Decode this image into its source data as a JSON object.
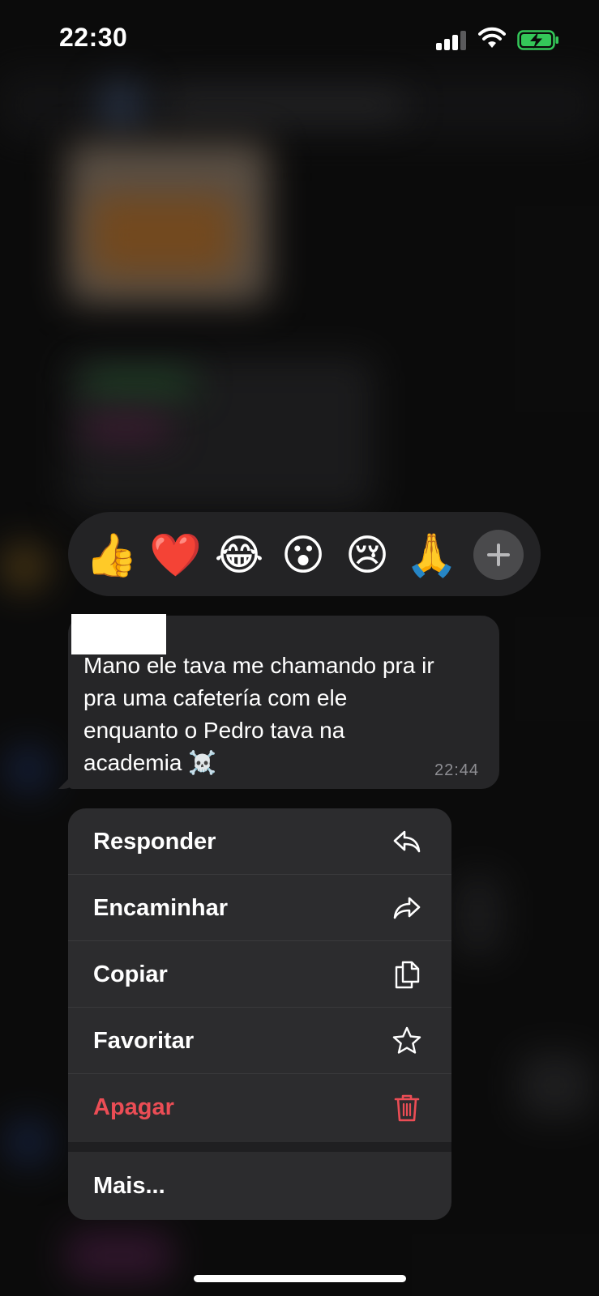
{
  "status_bar": {
    "time": "22:30",
    "signal_icon": "cellular-signal-icon",
    "wifi_icon": "wifi-icon",
    "battery_icon": "battery-charging-icon",
    "battery_color": "#34c759"
  },
  "reactions": {
    "items": [
      {
        "emoji": "👍",
        "name": "thumbs-up"
      },
      {
        "emoji": "❤️",
        "name": "heart"
      },
      {
        "emoji": "😂",
        "name": "laughing"
      },
      {
        "emoji": "😮",
        "name": "surprised"
      },
      {
        "emoji": "😢",
        "name": "crying"
      },
      {
        "emoji": "🙏",
        "name": "praying-hands"
      }
    ],
    "more_icon": "plus-icon"
  },
  "message": {
    "text": "Mano ele tava me chamando pra ir\npra uma cafetería com ele\nenquanto o Pedro tava na\nacademia ☠️",
    "time": "22:44"
  },
  "menu": {
    "items": [
      {
        "label": "Responder",
        "icon": "reply-icon"
      },
      {
        "label": "Encaminhar",
        "icon": "forward-icon"
      },
      {
        "label": "Copiar",
        "icon": "copy-icon"
      },
      {
        "label": "Favoritar",
        "icon": "star-icon"
      },
      {
        "label": "Apagar",
        "icon": "trash-icon",
        "color": "#eb4d55"
      }
    ],
    "more_label": "Mais..."
  }
}
